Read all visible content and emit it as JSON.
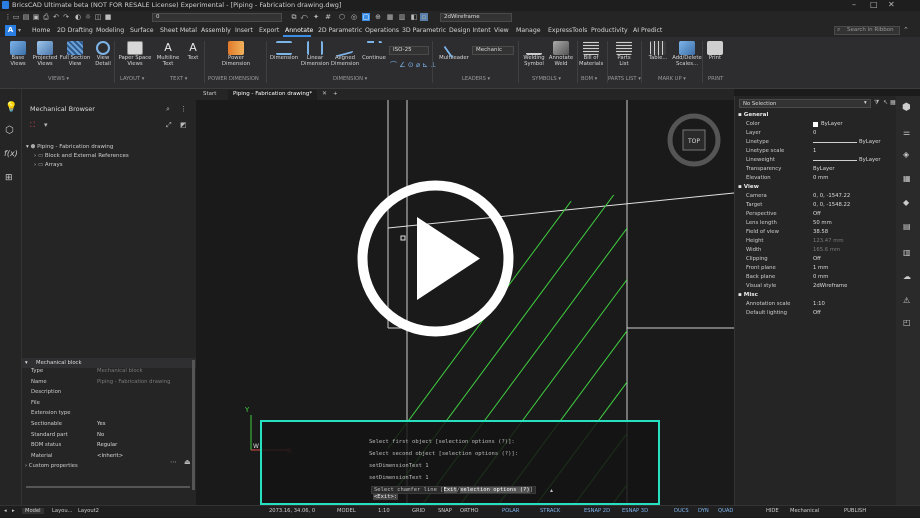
{
  "window": {
    "title": "BricsCAD Ultimate beta (NOT FOR RESALE License) Experimental - [Piping - Fabrication drawing.dwg]",
    "minimize": "–",
    "maximize": "□",
    "close": "✕"
  },
  "quick_access": {
    "layer_value": "0",
    "visual_style": "2dWireframe"
  },
  "ribbon_tabs": [
    "Home",
    "2D Drafting",
    "Modeling",
    "Surface",
    "Sheet Metal",
    "Assembly",
    "Insert",
    "Export",
    "Annotate",
    "2D Parametric",
    "Operations",
    "3D Parametric",
    "Design Intent",
    "View",
    "Manage",
    "ExpressTools",
    "Productivity",
    "AI Predict"
  ],
  "active_tab": "Annotate",
  "ribbon_search_placeholder": "Search in Ribbon",
  "ribbon": {
    "buttons": {
      "base_views": "Base\nViews",
      "projected_views": "Projected\nViews",
      "full_section_view": "Full Section\nView",
      "view_detail": "View\nDetail",
      "paper_space_views": "Paper Space\nViews",
      "multiline_text": "Multiline\nText",
      "text": "Text",
      "power_dimension": "Power\nDimension",
      "dimension": "Dimension",
      "linear_dimension": "Linear\nDimension",
      "aligned_dimension": "Aligned\nDimension",
      "continue": "Continue",
      "iso_style": "ISO-25",
      "multileader": "Multileader",
      "mechanic": "Mechanic",
      "welding_symbol": "Welding\nSymbol",
      "annotate_weld": "Annotate\nWeld",
      "bill_of_materials": "Bill of\nMaterials",
      "parts_list": "Parts\nList",
      "table": "Table...",
      "add_delete_scales": "Add/Delete\nScales...",
      "print": "Print"
    },
    "groups": [
      "VIEWS ▾",
      "LAYOUT ▾",
      "TEXT ▾",
      "POWER DIMENSION",
      "DIMENSION ▾",
      "LEADERS ▾",
      "SYMBOLS ▾",
      "BOM ▾",
      "PARTS LIST ▾",
      "MARK UP ▾",
      "PRINT"
    ]
  },
  "doc_tabs": [
    "Start",
    "Piping - Fabrication drawing*",
    "+"
  ],
  "mechanical_browser": {
    "title": "Mechanical Browser",
    "tree": [
      "Piping - Fabrication drawing",
      "Block and External References",
      "Arrays"
    ]
  },
  "mechanical_block": {
    "title": "Mechanical block",
    "rows": [
      {
        "label": "Type",
        "value": "Mechanical block",
        "dim": true
      },
      {
        "label": "Name",
        "value": "Piping - Fabrication drawing",
        "dim": true
      },
      {
        "label": "Description",
        "value": "",
        "dim": false
      },
      {
        "label": "File",
        "value": "",
        "dim": false
      },
      {
        "label": "Extension type",
        "value": "",
        "dim": false
      },
      {
        "label": "Sectionable",
        "value": "Yes",
        "dim": false
      },
      {
        "label": "Standard part",
        "value": "No",
        "dim": false
      },
      {
        "label": "BOM status",
        "value": "Regular",
        "dim": false
      },
      {
        "label": "Material",
        "value": "<Inherit>",
        "dim": false
      },
      {
        "label": "Custom properties",
        "value": "",
        "dim": false
      }
    ]
  },
  "properties": {
    "selection": "No Selection",
    "general_title": "General",
    "general": [
      {
        "label": "Color",
        "value": "ByLayer"
      },
      {
        "label": "Layer",
        "value": "0"
      },
      {
        "label": "Linetype",
        "value": "ByLayer"
      },
      {
        "label": "Linetype scale",
        "value": "1"
      },
      {
        "label": "Lineweight",
        "value": "ByLayer"
      },
      {
        "label": "Transparency",
        "value": "ByLayer"
      },
      {
        "label": "Elevation",
        "value": "0 mm"
      }
    ],
    "view_title": "View",
    "view": [
      {
        "label": "Camera",
        "value": "0, 0, -1547.22",
        "dim": false
      },
      {
        "label": "Target",
        "value": "0, 0, -1548.22",
        "dim": false
      },
      {
        "label": "Perspective",
        "value": "Off",
        "dim": false
      },
      {
        "label": "Lens length",
        "value": "50 mm",
        "dim": false
      },
      {
        "label": "Field of view",
        "value": "38.58",
        "dim": false
      },
      {
        "label": "Height",
        "value": "123.47 mm",
        "dim": true
      },
      {
        "label": "Width",
        "value": "165.6 mm",
        "dim": true
      },
      {
        "label": "Clipping",
        "value": "Off",
        "dim": false
      },
      {
        "label": "Front plane",
        "value": "1 mm",
        "dim": false
      },
      {
        "label": "Back plane",
        "value": "0 mm",
        "dim": false
      },
      {
        "label": "Visual style",
        "value": "2dWireframe",
        "dim": false
      }
    ],
    "misc_title": "Misc",
    "misc": [
      {
        "label": "Annotation scale",
        "value": "1:10"
      },
      {
        "label": "Default lighting",
        "value": "Off"
      }
    ]
  },
  "viewcube_label": "TOP",
  "ucs": {
    "x": "X",
    "y": "Y",
    "w": "W"
  },
  "command_lines": [
    "Select first object [selection options (?)]:",
    "Select second object [selection options (?)]:",
    "setDimensionText 1",
    "setDimensionText 1"
  ],
  "command_prompt": "Select chamfer line [",
  "command_opt1": "Exit",
  "command_opt2": "selection options (?)",
  "command_end": "]",
  "command_hint": "<Exit>:",
  "status": {
    "tab_model": "Model",
    "tab_layout1": "Layou...",
    "tab_layout2": "Layout2",
    "coords": "2073.16, 34.06, 0",
    "items": [
      "MODEL",
      "1:10",
      "GRID",
      "SNAP",
      "ORTHO",
      "POLAR",
      "STRACK",
      "ESNAP 2D",
      "ESNAP 3D",
      "DUCS",
      "DYN",
      "QUAD",
      "HIDE",
      "Mechanical",
      "PUBLISH"
    ]
  },
  "colors": {
    "accent": "#3a8ee6",
    "hatch": "#3fcf3f",
    "highlight": "#27e0c0",
    "ucs_x": "#e04848",
    "ucs_y": "#3fcf3f"
  }
}
